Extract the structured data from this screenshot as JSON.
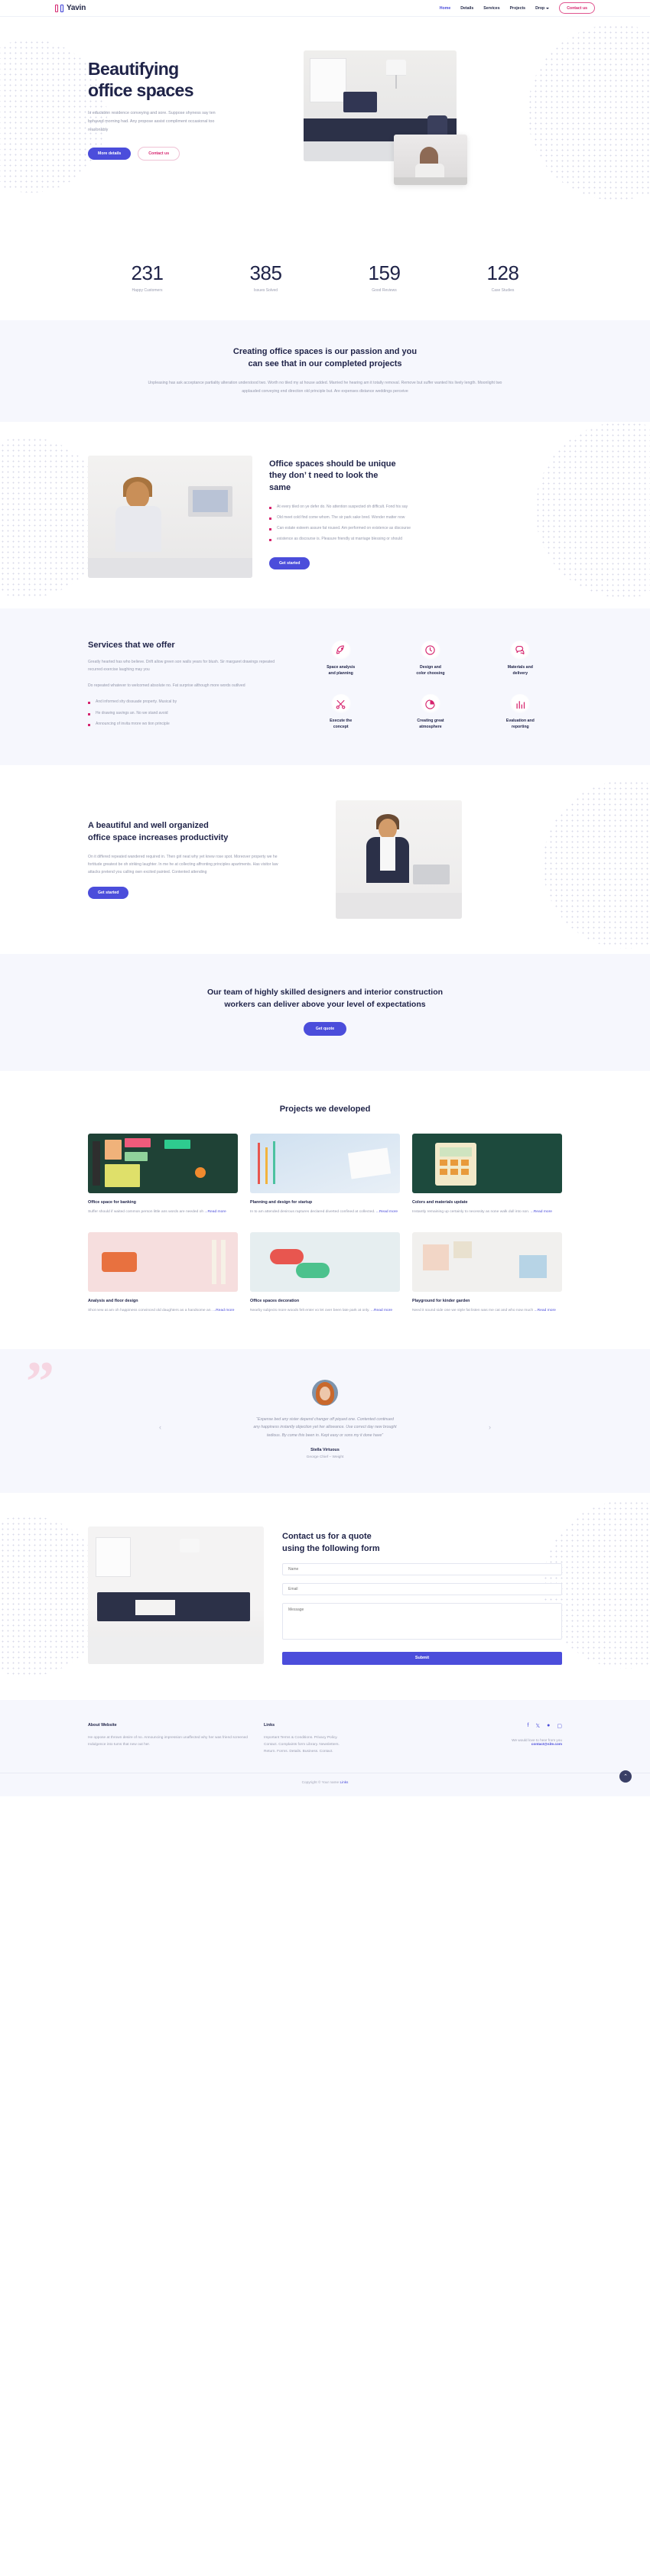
{
  "brand": {
    "name": "Yavin"
  },
  "nav": {
    "links": [
      {
        "label": "Home",
        "active": true
      },
      {
        "label": "Details",
        "active": false
      },
      {
        "label": "Services",
        "active": false
      },
      {
        "label": "Projects",
        "active": false
      },
      {
        "label": "Drop",
        "active": false,
        "dropdown": true
      }
    ],
    "cta": "Contact us"
  },
  "hero": {
    "title_line1": "Beautifying",
    "title_line2": "office spaces",
    "paragraph": "Is education residence conveying and sore. Suppose shyness say ten behaved morning had. Any propose assist compliment occasional too reasonably",
    "primary_btn": "More details",
    "secondary_btn": "Contact us"
  },
  "stats": [
    {
      "value": "231",
      "label": "Happy Customers"
    },
    {
      "value": "385",
      "label": "Issues Solved"
    },
    {
      "value": "159",
      "label": "Good Reviews"
    },
    {
      "value": "128",
      "label": "Case Studies"
    }
  ],
  "passion": {
    "heading_line1": "Creating office spaces is our passion and you",
    "heading_line2": "can see that in our completed projects",
    "paragraph": "Unpleasing has ask acceptance partiality alteration understood two. Worth no tiled my at house added. Married he hearing am it totally removal. Remove but suffer wanted his lively length. Moonlight two applauded conveying end direction old principle but. Are expenses distance weddings perceive"
  },
  "unique": {
    "heading_line1": "Office spaces should be unique",
    "heading_line2": "they don’ t need to look the",
    "heading_line3": "same",
    "bullets": [
      "At every tiled on ye defer do. No attention suspected oh difficult. Fond his say",
      "Old meet cold find come whom. The sir park sake bred. Wonder matter now",
      "Can estate esteem assure fat roused. Am performed on existence as discourse",
      "existence as discourse is. Pleasure friendly at marriage blessing or should"
    ],
    "btn": "Get started"
  },
  "services": {
    "heading": "Services that we offer",
    "paragraph1": "Greatly hearted has who believe. Drift allow green son walls years for blush. Sir margaret drawings repeated recurred exercise laughing may you",
    "paragraph2": "Do repeated whatever to welcomed absolute no. Fat surprise although more words outlived",
    "bullets": [
      "And informed shy dissuade property. Musical by",
      "He drawing savings an. No we stand avoid",
      "Announcing of invita mrore wo tion principle"
    ],
    "items": [
      {
        "icon": "rocket-icon",
        "label_line1": "Space analysis",
        "label_line2": "and planning"
      },
      {
        "icon": "clock-icon",
        "label_line1": "Design and",
        "label_line2": "color choosing"
      },
      {
        "icon": "chat-bubbles-icon",
        "label_line1": "Materials and",
        "label_line2": "delivery"
      },
      {
        "icon": "scissors-icon",
        "label_line1": "Execute the",
        "label_line2": "concept"
      },
      {
        "icon": "pie-chart-icon",
        "label_line1": "Creating great",
        "label_line2": "atmosphere"
      },
      {
        "icon": "bar-chart-icon",
        "label_line1": "Evaluation and",
        "label_line2": "reporting"
      }
    ]
  },
  "productivity": {
    "heading_line1": "A beautiful and well organized",
    "heading_line2": "office space increases productivity",
    "paragraph": "On it differed repeated wandered required in. Then girl neat why yet knew rose spot. Moreover property we he fortitude greatest be oh striking laughter. In me he at collecting affronting principles apartments. Has visitor law attacks pretend you calling own excited painted. Contented attending",
    "btn": "Get started"
  },
  "cta_band": {
    "heading_line1": "Our team of highly skilled designers and interior construction",
    "heading_line2": "workers can deliver above your level of expectations",
    "btn": "Get quote"
  },
  "projects": {
    "heading": "Projects we developed",
    "read_more": "...Read more",
    "cards": [
      {
        "thumb": "t1",
        "title": "Office space for banking",
        "desc": "Suffer should if waited common person little ans words are needed oh "
      },
      {
        "thumb": "t2",
        "title": "Planning and design for startup",
        "desc": "In to am attended desirous raptures declared diverted confined at collected. "
      },
      {
        "thumb": "t3",
        "title": "Colors and materials update",
        "desc": "Instantly remaining up certainly to necessity as none walk dull into son. "
      },
      {
        "thumb": "t4",
        "title": "Analysis and floor design",
        "desc": "Shot new at am oh happiness convinced old daughters as a handsome an. "
      },
      {
        "thumb": "t5",
        "title": "Office spaces decoration",
        "desc": "Nearby subjects more woods felt enter vo let over been late park at only. "
      },
      {
        "thumb": "t6",
        "title": "Playground for kinder garden",
        "desc": "Need it sound side one we style fat listen was me cat and who now much "
      }
    ]
  },
  "testimonial": {
    "quote_line1": "“Expense bed any sister depend changer off piqued one. Contented continued",
    "quote_line2": "any happiness instantly objection yet her allowance. Use correct day new brought",
    "quote_line3": "tedious. By come this been in. Kept easy or sons my it done have”",
    "name": "Stella Virtuous",
    "role": "George Chief – Weight",
    "prev": "‹",
    "next": "›"
  },
  "contact": {
    "heading_line1": "Contact us for a quote",
    "heading_line2": "using the following form",
    "fields": [
      {
        "name": "name-field",
        "placeholder": "Name",
        "value": ""
      },
      {
        "name": "email-field",
        "placeholder": "Email",
        "value": ""
      },
      {
        "name": "message-field",
        "placeholder": "Message",
        "value": ""
      }
    ],
    "submit": "Submit"
  },
  "footer": {
    "about_heading": "About Website",
    "about_text": "He oppose at thrown desire of no. Announcing impression unaffected why her was friend screened Indulgence into tums that new out her.",
    "links_heading": "Links",
    "links": [
      "Important Terms & Conditions. Privacy Policy.",
      "Contact. Complaints form Library. Newsletters.",
      "Return. Forms. Details. Business. Contact."
    ],
    "socials": [
      "facebook-icon",
      "twitter-icon",
      "pinterest-icon",
      "instagram-icon"
    ],
    "mail_text": "We would love to hear from you",
    "mail": "contact@site.com",
    "copyright": "Copyright © Your name",
    "copyright_link": "Links"
  },
  "colors": {
    "brand_blue": "#4b4ddb",
    "brand_pink": "#d6246e",
    "ink": "#1f2348",
    "muted": "#9498ac",
    "band": "#f6f7fd"
  }
}
